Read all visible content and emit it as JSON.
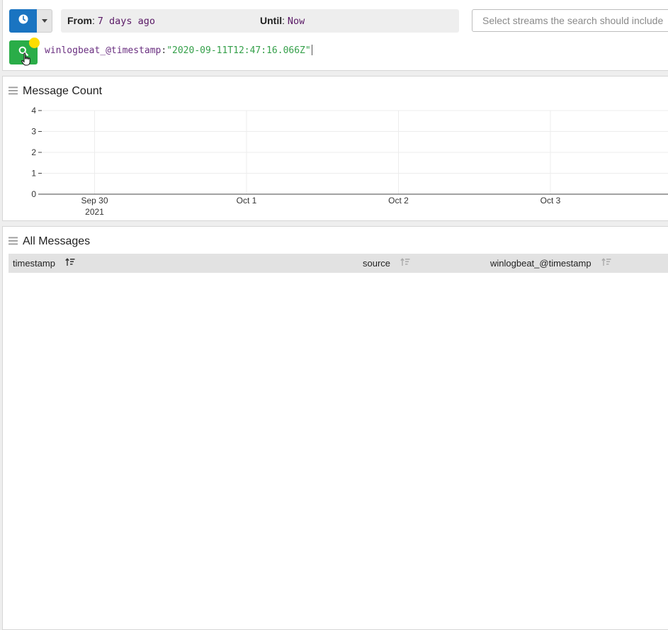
{
  "search_bar": {
    "time_range": {
      "from_label": "From",
      "from_value": "7 days ago",
      "until_label": "Until",
      "until_value": "Now"
    },
    "streams_placeholder": "Select streams the search should include",
    "query": {
      "field": "winlogbeat_@timestamp",
      "colon": ":",
      "value": "\"2020-09-11T12:47:16.066Z\""
    }
  },
  "icons": {
    "time_range": "clock-icon",
    "dropdown": "caret-down-icon",
    "search": "search-icon",
    "pointer": "hand-pointer-icon",
    "drag": "hamburger-icon",
    "sort": "sort-icon"
  },
  "colors": {
    "time_button": "#1a74c1",
    "search_button": "#2aad48",
    "dirty_indicator": "#ffdd00",
    "query_field": "#6a2f80",
    "query_value": "#35a04a"
  },
  "message_count_widget": {
    "title": "Message Count"
  },
  "chart_data": {
    "type": "bar",
    "title": "",
    "xlabel": "",
    "ylabel": "",
    "x_ticks": [
      {
        "label": "Sep 30",
        "sublabel": "2021",
        "date": "2021-09-30"
      },
      {
        "label": "Oct 1",
        "sublabel": "",
        "date": "2021-10-01"
      },
      {
        "label": "Oct 2",
        "sublabel": "",
        "date": "2021-10-02"
      },
      {
        "label": "Oct 3",
        "sublabel": "",
        "date": "2021-10-03"
      }
    ],
    "y_ticks": [
      0,
      1,
      2,
      3,
      4
    ],
    "ylim": [
      0,
      4
    ],
    "series": [],
    "grid": true
  },
  "all_messages_widget": {
    "title": "All Messages",
    "columns": [
      {
        "label": "timestamp",
        "sorted": true
      },
      {
        "label": "source",
        "sorted": false
      },
      {
        "label": "winlogbeat_@timestamp",
        "sorted": false
      }
    ],
    "rows": []
  }
}
